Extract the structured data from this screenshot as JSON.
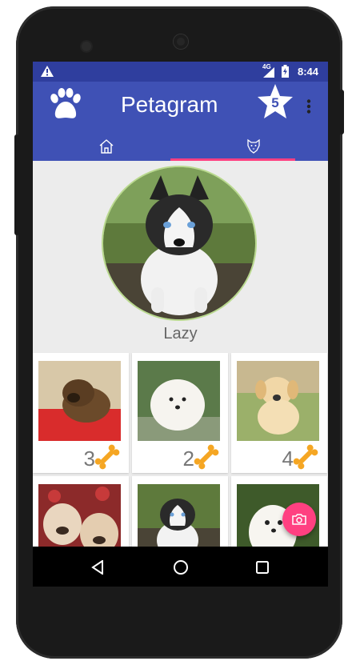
{
  "statusbar": {
    "warning_icon": "warning-icon",
    "network_label": "4G",
    "time": "8:44"
  },
  "appbar": {
    "title": "Petagram",
    "logo_icon": "paw-icon",
    "rating_badge": "5",
    "menu_icon": "more-vert-icon"
  },
  "tabs": [
    {
      "icon": "home-icon",
      "selected": false
    },
    {
      "icon": "dog-face-icon",
      "selected": true
    }
  ],
  "profile": {
    "name": "Lazy",
    "photo": "husky-puppy"
  },
  "pets": [
    {
      "photo": "brown-puppy-on-red-blanket",
      "likes": "3"
    },
    {
      "photo": "white-pomeranian",
      "likes": "2"
    },
    {
      "photo": "golden-retriever-puppy",
      "likes": "4"
    },
    {
      "photo": "bulldog-puppies",
      "likes": ""
    },
    {
      "photo": "husky-puppy",
      "likes": ""
    },
    {
      "photo": "white-maltese",
      "likes": ""
    }
  ],
  "fab": {
    "icon": "camera-icon"
  },
  "navbar": {
    "back_icon": "back-icon",
    "home_icon": "home-circle-icon",
    "recents_icon": "recents-icon"
  },
  "colors": {
    "primary": "#3f51b5",
    "primary_dark": "#2f3e9e",
    "accent": "#ff4081",
    "bone": "#f5a623"
  }
}
